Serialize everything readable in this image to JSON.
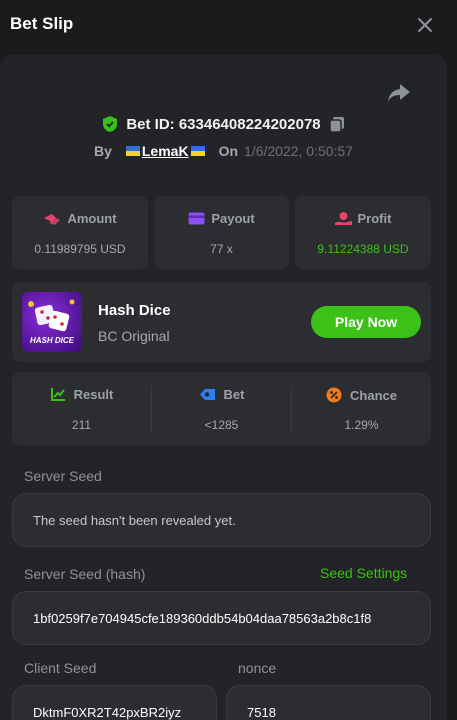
{
  "header": {
    "title": "Bet Slip"
  },
  "bet": {
    "id_label": "Bet ID: 63346408224202078",
    "by_label": "By",
    "user": "LemaK",
    "on_label": "On",
    "date": "1/6/2022, 0:50:57"
  },
  "stats": {
    "amount_label": "Amount",
    "amount_value": "0.11989795 USD",
    "payout_label": "Payout",
    "payout_value": "77 x",
    "profit_label": "Profit",
    "profit_value": "9.11224388 USD"
  },
  "game": {
    "name": "Hash Dice",
    "subtitle": "BC Original",
    "thumb_text": "HASH DICE",
    "play_label": "Play Now"
  },
  "result": {
    "result_label": "Result",
    "result_value": "211",
    "bet_label": "Bet",
    "bet_value": "<1285",
    "chance_label": "Chance",
    "chance_value": "1.29%"
  },
  "seeds": {
    "server_label": "Server Seed",
    "server_value": "The seed hasn't been revealed yet.",
    "hash_label": "Server Seed (hash)",
    "settings_label": "Seed Settings",
    "hash_value": "1bf0259f7e704945cfe189360ddb54b04daa78563a2b8c1f8",
    "client_label": "Client Seed",
    "client_value": "DktmF0XR2T42pxBR2iyz",
    "nonce_label": "nonce",
    "nonce_value": "7518"
  },
  "colors": {
    "accent_green": "#3bc117",
    "panel": "#232427",
    "card": "#2c2d31"
  },
  "icons": [
    "close-icon",
    "share-icon",
    "shield-check-icon",
    "copy-icon",
    "amount-icon",
    "payout-icon",
    "profit-icon",
    "result-icon",
    "bet-icon",
    "chance-icon"
  ]
}
